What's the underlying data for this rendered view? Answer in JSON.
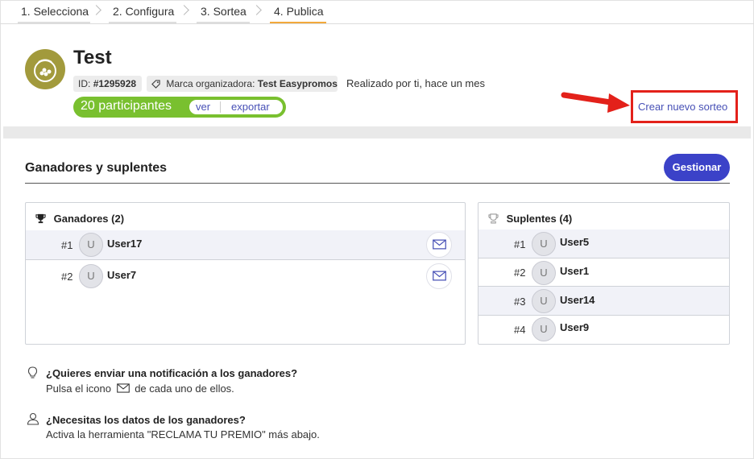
{
  "stepper": {
    "steps": [
      {
        "label": "1. Selecciona"
      },
      {
        "label": "2. Configura"
      },
      {
        "label": "3. Sortea"
      },
      {
        "label": "4. Publica"
      }
    ],
    "active_color": "#f2a93b"
  },
  "header": {
    "title": "Test",
    "id_label": "ID:",
    "id_value": "#1295928",
    "brand_label": "Marca organizadora:",
    "brand_value": "Test Easypromos",
    "realizado": "Realizado por ti, hace un mes",
    "participants_count": "20 participantes",
    "ver": "ver",
    "exportar": "exportar",
    "crear_nuevo": "Crear nuevo sorteo"
  },
  "section": {
    "title": "Ganadores y suplentes",
    "gestionar": "Gestionar"
  },
  "ganadores": {
    "header": "Ganadores (2)",
    "rows": [
      {
        "rank": "#1",
        "initial": "U",
        "name": "User17"
      },
      {
        "rank": "#2",
        "initial": "U",
        "name": "User7"
      }
    ]
  },
  "suplentes": {
    "header": "Suplentes (4)",
    "rows": [
      {
        "rank": "#1",
        "initial": "U",
        "name": "User5"
      },
      {
        "rank": "#2",
        "initial": "U",
        "name": "User1"
      },
      {
        "rank": "#3",
        "initial": "U",
        "name": "User14"
      },
      {
        "rank": "#4",
        "initial": "U",
        "name": "User9"
      }
    ]
  },
  "tips": {
    "notify_q": "¿Quieres enviar una notificación a los ganadores?",
    "notify_a_pre": "Pulsa el icono",
    "notify_a_post": "de cada uno de ellos.",
    "data_q": "¿Necesitas los datos de los ganadores?",
    "data_a": "Activa la herramienta \"RECLAMA TU PREMIO\" más abajo."
  },
  "colors": {
    "accent": "#3b42c8",
    "link": "#4750b6",
    "participants_green": "#79c02f",
    "annotation_red": "#e3211a"
  }
}
